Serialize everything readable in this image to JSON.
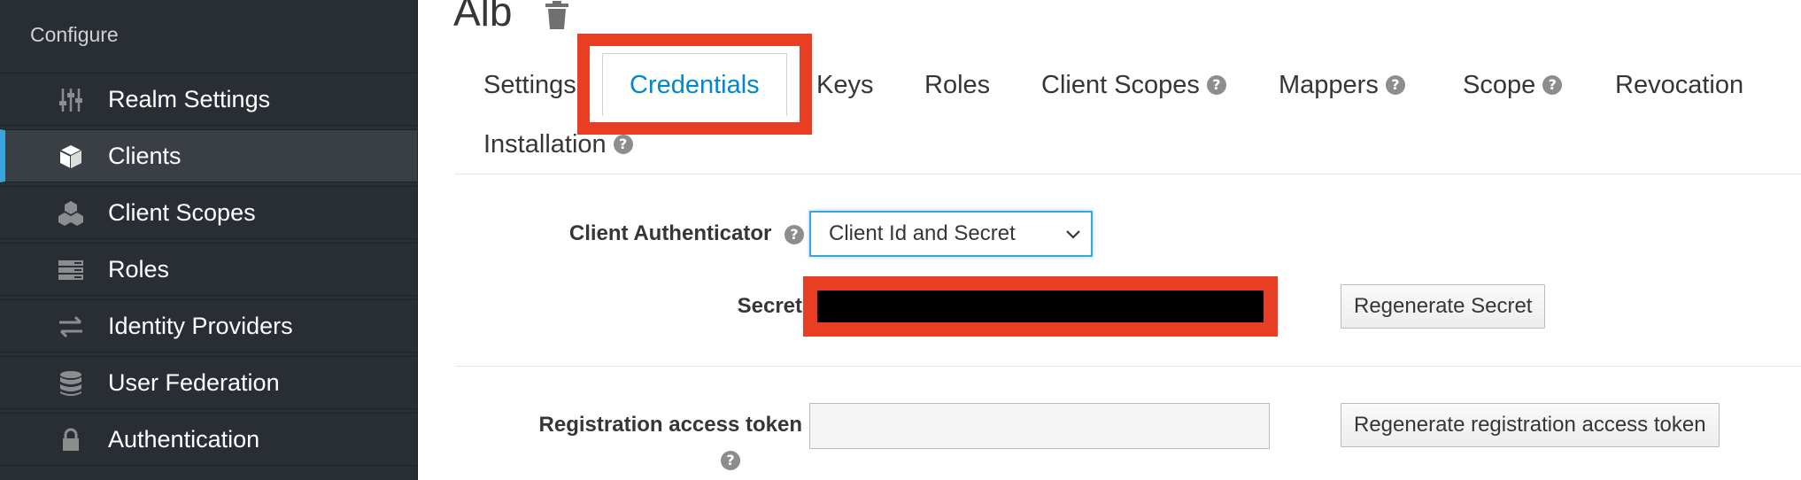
{
  "sidebar": {
    "heading": "Configure",
    "items": [
      {
        "label": "Realm Settings",
        "icon": "sliders-icon",
        "active": false
      },
      {
        "label": "Clients",
        "icon": "cube-icon",
        "active": true
      },
      {
        "label": "Client Scopes",
        "icon": "cubes-icon",
        "active": false
      },
      {
        "label": "Roles",
        "icon": "list-icon",
        "active": false
      },
      {
        "label": "Identity Providers",
        "icon": "exchange-icon",
        "active": false
      },
      {
        "label": "User Federation",
        "icon": "database-icon",
        "active": false
      },
      {
        "label": "Authentication",
        "icon": "lock-icon",
        "active": false
      }
    ]
  },
  "main": {
    "title": "Alb",
    "tabs": [
      {
        "label": "Settings",
        "help": false
      },
      {
        "label": "Credentials",
        "help": false,
        "active": true
      },
      {
        "label": "Keys",
        "help": false
      },
      {
        "label": "Roles",
        "help": false
      },
      {
        "label": "Client Scopes",
        "help": true
      },
      {
        "label": "Mappers",
        "help": true
      },
      {
        "label": "Scope",
        "help": true
      },
      {
        "label": "Revocation",
        "help": false
      },
      {
        "label": "Installation",
        "help": true
      }
    ],
    "form": {
      "authenticator_label": "Client Authenticator",
      "authenticator_value": "Client Id and Secret",
      "secret_label": "Secret",
      "regenerate_secret": "Regenerate Secret",
      "token_label": "Registration access token",
      "token_value": "",
      "regenerate_token": "Regenerate registration access token"
    }
  },
  "colors": {
    "sidebar_bg": "#292e34",
    "active_accent": "#39a5dc",
    "active_tab_text": "#0088ce",
    "highlight_red": "#e83e24"
  }
}
